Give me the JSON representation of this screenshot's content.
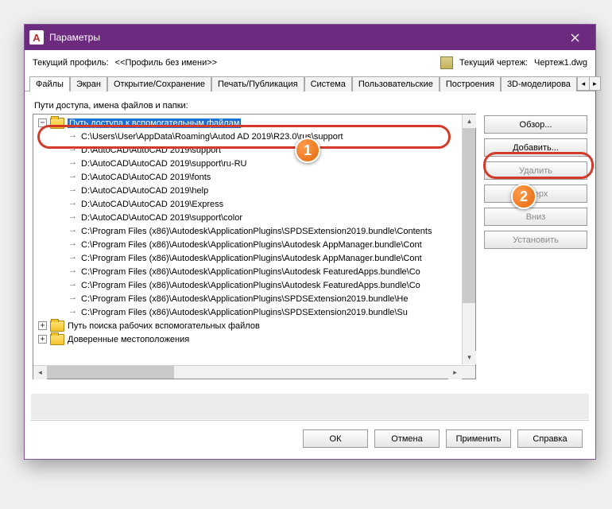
{
  "window": {
    "title": "Параметры"
  },
  "info": {
    "profile_label": "Текущий профиль:",
    "profile_value": "<<Профиль без имени>>",
    "drawing_label": "Текущий чертеж:",
    "drawing_value": "Чертеж1.dwg"
  },
  "tabs": {
    "items": [
      "Файлы",
      "Экран",
      "Открытие/Сохранение",
      "Печать/Публикация",
      "Система",
      "Пользовательские",
      "Построения",
      "3D-моделирова"
    ],
    "active_index": 0
  },
  "section": {
    "label": "Пути доступа, имена файлов и папки:"
  },
  "tree": {
    "root": {
      "label": "Путь доступа к вспомогательным файлам",
      "selected": true,
      "twisty": "−"
    },
    "paths": [
      "C:\\Users\\User\\AppData\\Roaming\\Autod            AD 2019\\R23.0\\rus\\support",
      "D:\\AutoCAD\\AutoCAD 2019\\support",
      "D:\\AutoCAD\\AutoCAD 2019\\support\\ru-RU",
      "D:\\AutoCAD\\AutoCAD 2019\\fonts",
      "D:\\AutoCAD\\AutoCAD 2019\\help",
      "D:\\AutoCAD\\AutoCAD 2019\\Express",
      "D:\\AutoCAD\\AutoCAD 2019\\support\\color",
      "C:\\Program Files (x86)\\Autodesk\\ApplicationPlugins\\SPDSExtension2019.bundle\\Contents",
      "C:\\Program Files (x86)\\Autodesk\\ApplicationPlugins\\Autodesk AppManager.bundle\\Cont",
      "C:\\Program Files (x86)\\Autodesk\\ApplicationPlugins\\Autodesk AppManager.bundle\\Cont",
      "C:\\Program Files (x86)\\Autodesk\\ApplicationPlugins\\Autodesk FeaturedApps.bundle\\Co",
      "C:\\Program Files (x86)\\Autodesk\\ApplicationPlugins\\Autodesk FeaturedApps.bundle\\Co",
      "C:\\Program Files (x86)\\Autodesk\\ApplicationPlugins\\SPDSExtension2019.bundle\\He",
      "C:\\Program Files (x86)\\Autodesk\\ApplicationPlugins\\SPDSExtension2019.bundle\\Su"
    ],
    "siblings": [
      {
        "label": "Путь поиска рабочих вспомогательных файлов",
        "twisty": "+"
      },
      {
        "label": "Доверенные местоположения",
        "twisty": "+"
      }
    ]
  },
  "sidebuttons": {
    "browse": "Обзор...",
    "add": "Добавить...",
    "remove": "Удалить",
    "up": "Вверх",
    "down": "Вниз",
    "setcurrent": "Установить"
  },
  "dialog_buttons": {
    "ok": "ОК",
    "cancel": "Отмена",
    "apply": "Применить",
    "help": "Справка"
  },
  "callouts": {
    "one": "1",
    "two": "2"
  }
}
